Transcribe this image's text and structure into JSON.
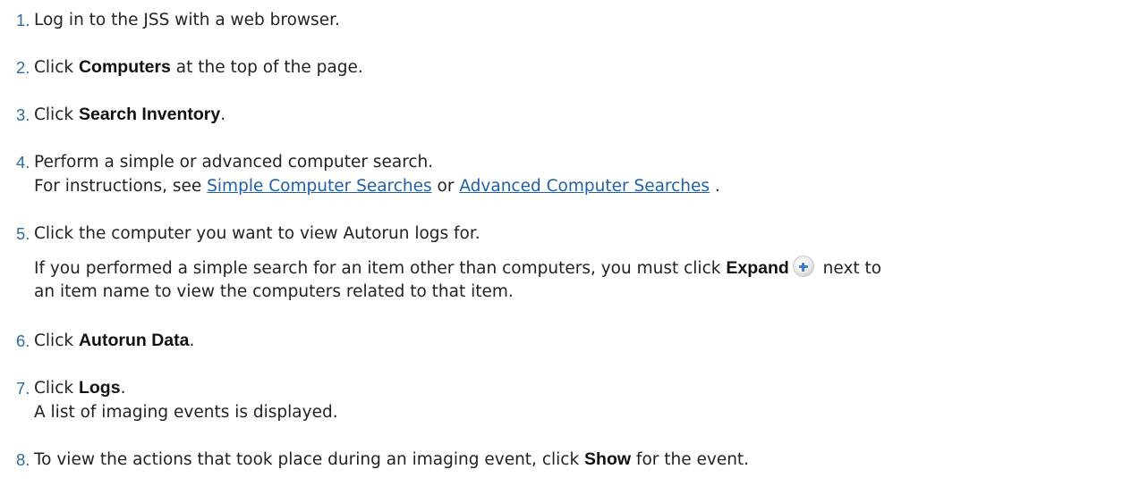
{
  "steps": [
    {
      "number": "1.",
      "text": "Log in to the JSS with a web browser."
    },
    {
      "number": "2.",
      "pre": "Click ",
      "bold": "Computers",
      "post": " at the top of the page."
    },
    {
      "number": "3.",
      "pre": "Click ",
      "bold": "Search Inventory",
      "post": "."
    },
    {
      "number": "4.",
      "text": "Perform a simple or advanced computer search.",
      "sub_pre": "For instructions, see ",
      "link1": "Simple Computer Searches",
      "sub_mid": " or ",
      "link2": "Advanced Computer Searches",
      "sub_post": " ."
    },
    {
      "number": "5.",
      "text": "Click the computer you want to view Autorun logs for.",
      "note_pre": "If you performed a simple search for an item other than computers, you must click ",
      "note_bold": "Expand",
      "note_post": " next to",
      "note_line2": "an item name to view the computers related to that item.",
      "icon": "plus-circle-icon"
    },
    {
      "number": "6.",
      "pre": "Click ",
      "bold": "Autorun Data",
      "post": "."
    },
    {
      "number": "7.",
      "pre": "Click ",
      "bold": "Logs",
      "post": ".",
      "sub": "A list of imaging events is displayed."
    },
    {
      "number": "8.",
      "pre": "To view the actions that took place during an imaging event, click ",
      "bold": "Show",
      "post": " for the event."
    }
  ]
}
